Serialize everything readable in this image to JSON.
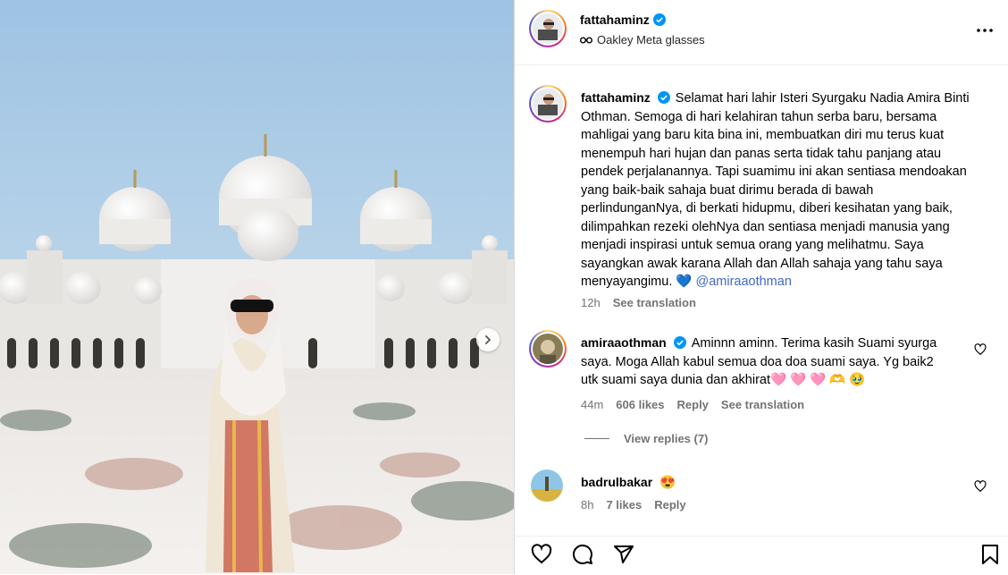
{
  "post": {
    "author": "fattahaminz",
    "subtitle": "Oakley Meta glasses",
    "subtitle_icon": "glasses-icon"
  },
  "caption": {
    "author": "fattahaminz",
    "text": "Selamat hari lahir Isteri Syurgaku Nadia Amira Binti Othman. Semoga di hari kelahiran tahun serba baru, bersama mahligai yang baru kita bina ini, membuatkan diri mu terus kuat menempuh hari hujan dan panas serta tidak tahu panjang atau pendek perjalanannya. Tapi suamimu ini akan sentiasa mendoakan yang baik-baik sahaja buat dirimu berada di bawah perlindunganNya, di berkati hidupmu, diberi kesihatan yang baik, dilimpahkan rezeki olehNya dan sentiasa menjadi manusia yang menjadi inspirasi untuk semua orang yang melihatmu. Saya sayangkan awak karana Allah dan Allah sahaja yang tahu saya menyayangimu.",
    "emoji": "💙",
    "mention": "@amiraaothman",
    "time": "12h",
    "translate": "See translation"
  },
  "comments": [
    {
      "author": "amiraaothman",
      "text": "Aminnn aminn. Terima kasih Suami syurga saya. Moga Allah kabul semua doa doa suami saya. Yg baik2 utk suami saya dunia dan akhirat🩷 🩷 🩷 🫶 🥹",
      "time": "44m",
      "likes": "606 likes",
      "reply": "Reply",
      "translate": "See translation",
      "view_replies": "View replies (7)"
    },
    {
      "author": "badrulbakar",
      "text": "😍",
      "time": "8h",
      "likes": "7 likes",
      "reply": "Reply"
    }
  ],
  "colors": {
    "verified": "#0095f6",
    "mention": "#4169c9",
    "muted": "#737373"
  },
  "icons": [
    "heart-icon",
    "comment-icon",
    "share-icon",
    "bookmark-icon",
    "more-icon",
    "verified-icon",
    "chevron-right-icon"
  ]
}
